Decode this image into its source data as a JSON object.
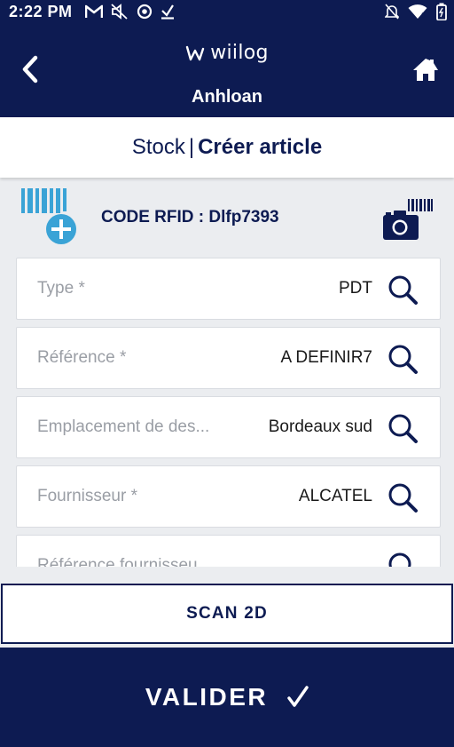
{
  "status_bar": {
    "time": "2:22 PM",
    "left_icons": [
      "gmail-icon",
      "mute-icon",
      "sync-icon",
      "download-icon"
    ],
    "right_icons": [
      "notifications-off-icon",
      "wifi-icon",
      "battery-icon"
    ]
  },
  "header": {
    "logo_text": "wiilog",
    "user_name": "Anhloan",
    "back_icon": "chevron-left-icon",
    "home_icon": "home-icon"
  },
  "title": {
    "section": "Stock",
    "separator": "|",
    "page": "Créer article"
  },
  "rfid": {
    "label": "CODE RFID : Dlfp7393",
    "add_icon": "barcode-add-icon",
    "camera_icon": "camera-barcode-icon"
  },
  "fields": [
    {
      "label": "Type *",
      "value": "PDT"
    },
    {
      "label": "Référence *",
      "value": "A DEFINIR7"
    },
    {
      "label": "Emplacement de des...",
      "value": "Bordeaux sud"
    },
    {
      "label": "Fournisseur *",
      "value": "ALCATEL"
    },
    {
      "label": "Référence fournisseu",
      "value": ""
    }
  ],
  "buttons": {
    "scan_label": "SCAN 2D",
    "validate_label": "VALIDER",
    "validate_icon": "checkmark-icon"
  },
  "colors": {
    "primary": "#0d1b52",
    "accent": "#3aa3d6",
    "background": "#ebedf0"
  }
}
